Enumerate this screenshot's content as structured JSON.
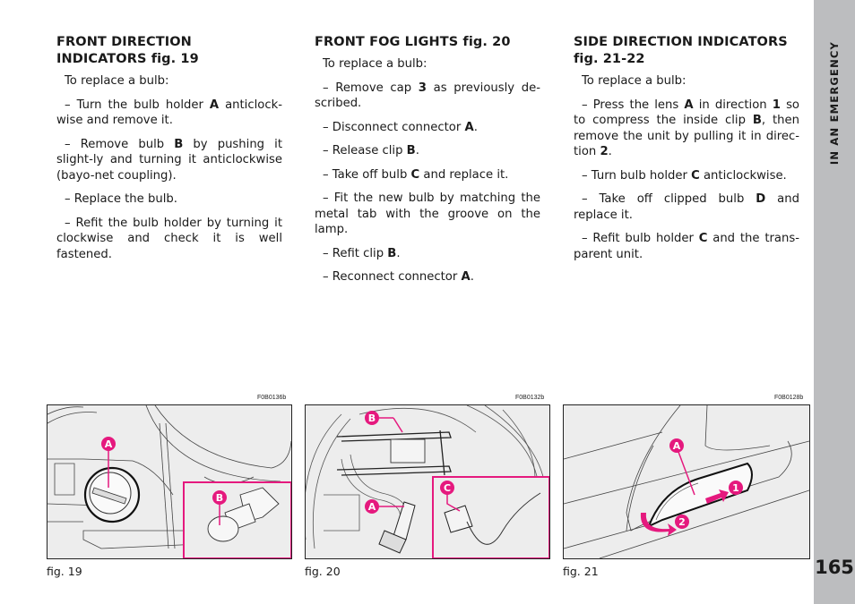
{
  "sections": [
    {
      "title_main": "FRONT DIRECTION INDICATORS",
      "title_fig": "fig. 19",
      "intro": "To replace a bulb:",
      "steps": [
        [
          "– Turn the bulb holder ",
          "A",
          " anticlock-wise and remove it."
        ],
        [
          "– Remove bulb ",
          "B",
          " by pushing it slight-ly and turning it anticlockwise (bayo-net coupling)."
        ],
        [
          "– Replace the bulb.",
          "",
          ""
        ],
        [
          "– Refit the bulb holder by turning it clockwise and check it is well fastened.",
          "",
          ""
        ]
      ]
    },
    {
      "title_main": "FRONT FOG LIGHTS",
      "title_fig": "fig. 20",
      "intro": "To replace a bulb:",
      "steps": [
        [
          "– Remove cap ",
          "3",
          " as previously de-scribed."
        ],
        [
          "– Disconnect connector ",
          "A",
          "."
        ],
        [
          "– Release clip ",
          "B",
          "."
        ],
        [
          "– Take off bulb ",
          "C",
          " and replace it."
        ],
        [
          "– Fit the new bulb by matching the metal tab with the groove on the lamp.",
          "",
          ""
        ],
        [
          "– Refit clip ",
          "B",
          "."
        ],
        [
          "– Reconnect connector ",
          "A",
          "."
        ]
      ]
    },
    {
      "title_main": "SIDE DIRECTION INDICATORS",
      "title_fig": "fig. 21-22",
      "intro": "To replace a bulb:",
      "steps": [
        [
          "– Press the lens ",
          "A",
          " in direction ",
          "1",
          " so to compress the inside clip ",
          "B",
          ", then remove the unit by pulling it in direc-tion ",
          "2",
          "."
        ],
        [
          "– Turn bulb holder ",
          "C",
          " anticlockwise."
        ],
        [
          "– Take off clipped bulb ",
          "D",
          " and replace it."
        ],
        [
          "– Refit bulb holder ",
          "C",
          " and the trans-parent unit."
        ]
      ]
    }
  ],
  "figures": [
    {
      "code": "F0B0136b",
      "caption": "fig. 19",
      "callouts": [
        "A",
        "B"
      ]
    },
    {
      "code": "F0B0132b",
      "caption": "fig. 20",
      "callouts": [
        "B",
        "A",
        "C"
      ]
    },
    {
      "code": "F0B0128b",
      "caption": "fig. 21",
      "callouts": [
        "A",
        "1",
        "2"
      ]
    }
  ],
  "sidebar": {
    "label": "IN AN EMERGENCY",
    "page_number": "165"
  },
  "colors": {
    "accent": "#e5197e",
    "sidebar": "#bcbdbf",
    "figure_bg": "#ededed"
  }
}
